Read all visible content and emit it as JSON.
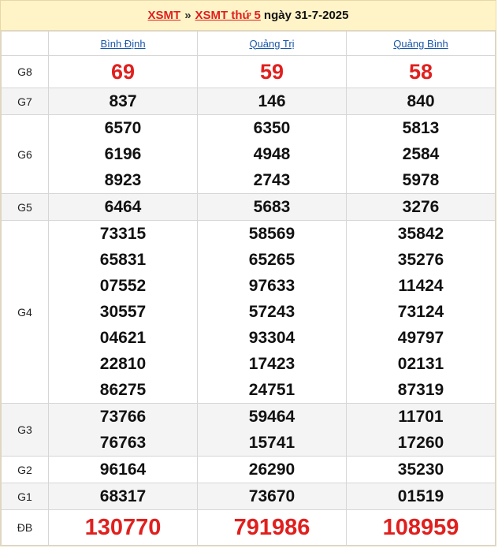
{
  "header": {
    "link1": "XSMT",
    "sep": "»",
    "link2": "XSMT thứ 5",
    "date": "ngày 31-7-2025"
  },
  "provinces": [
    "Bình Định",
    "Quảng Trị",
    "Quảng Bình"
  ],
  "prizes": [
    {
      "label": "G8",
      "results": [
        [
          "69"
        ],
        [
          "59"
        ],
        [
          "58"
        ]
      ]
    },
    {
      "label": "G7",
      "results": [
        [
          "837"
        ],
        [
          "146"
        ],
        [
          "840"
        ]
      ]
    },
    {
      "label": "G6",
      "results": [
        [
          "6570",
          "6196",
          "8923"
        ],
        [
          "6350",
          "4948",
          "2743"
        ],
        [
          "5813",
          "2584",
          "5978"
        ]
      ]
    },
    {
      "label": "G5",
      "results": [
        [
          "6464"
        ],
        [
          "5683"
        ],
        [
          "3276"
        ]
      ]
    },
    {
      "label": "G4",
      "results": [
        [
          "73315",
          "65831",
          "07552",
          "30557",
          "04621",
          "22810",
          "86275"
        ],
        [
          "58569",
          "65265",
          "97633",
          "57243",
          "93304",
          "17423",
          "24751"
        ],
        [
          "35842",
          "35276",
          "11424",
          "73124",
          "49797",
          "02131",
          "87319"
        ]
      ]
    },
    {
      "label": "G3",
      "results": [
        [
          "73766",
          "76763"
        ],
        [
          "59464",
          "15741"
        ],
        [
          "11701",
          "17260"
        ]
      ]
    },
    {
      "label": "G2",
      "results": [
        [
          "96164"
        ],
        [
          "26290"
        ],
        [
          "35230"
        ]
      ]
    },
    {
      "label": "G1",
      "results": [
        [
          "68317"
        ],
        [
          "73670"
        ],
        [
          "01519"
        ]
      ]
    },
    {
      "label": "ĐB",
      "results": [
        [
          "130770"
        ],
        [
          "791986"
        ],
        [
          "108959"
        ]
      ]
    }
  ]
}
